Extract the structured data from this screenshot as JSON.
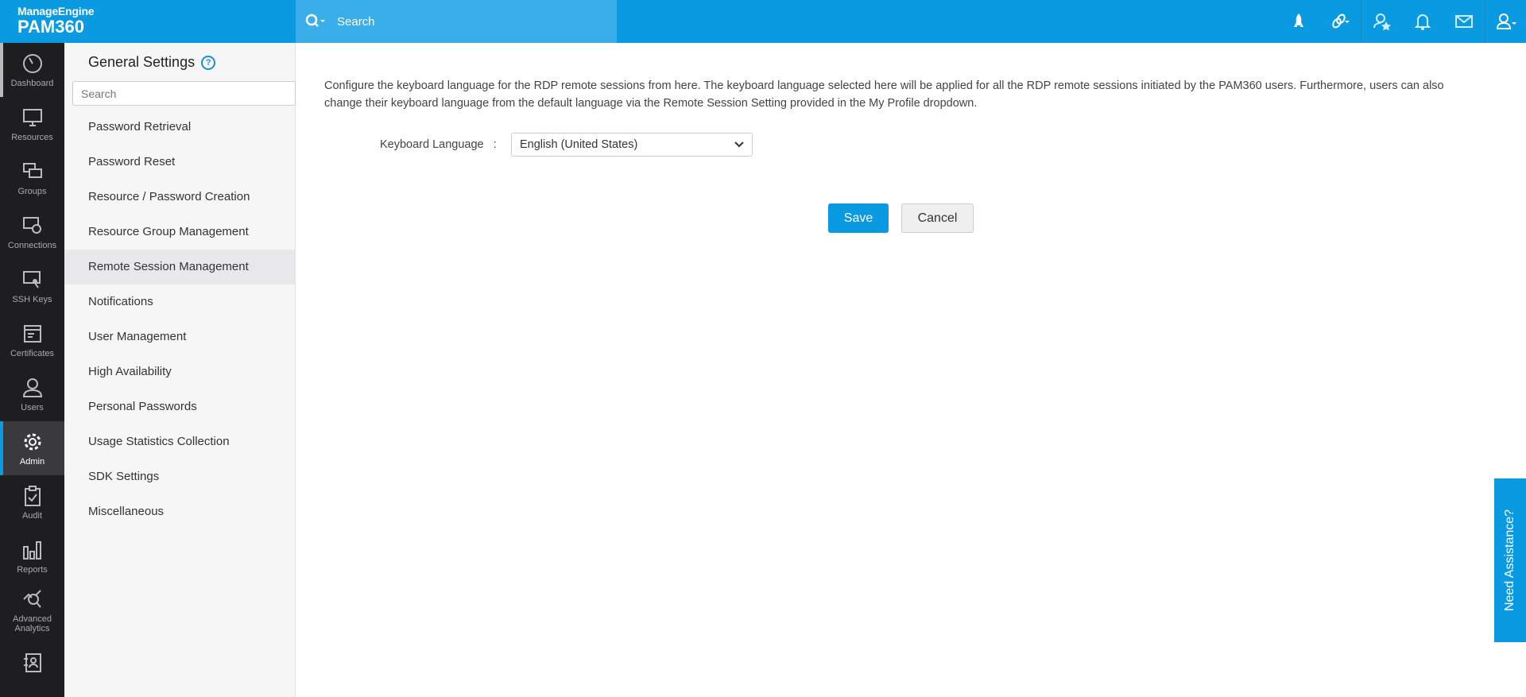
{
  "header": {
    "brand": "ManageEngine",
    "product": "PAM360",
    "search_placeholder": "Search",
    "icons": [
      "rocket-icon",
      "link-icon",
      "user-star-icon",
      "bell-icon",
      "mail-icon",
      "user-icon"
    ]
  },
  "sidebar": {
    "items": [
      {
        "label": "Dashboard",
        "icon": "gauge-icon"
      },
      {
        "label": "Resources",
        "icon": "monitor-icon"
      },
      {
        "label": "Groups",
        "icon": "groups-icon"
      },
      {
        "label": "Connections",
        "icon": "connections-icon"
      },
      {
        "label": "SSH Keys",
        "icon": "key-icon"
      },
      {
        "label": "Certificates",
        "icon": "certificate-icon"
      },
      {
        "label": "Users",
        "icon": "user-icon"
      },
      {
        "label": "Admin",
        "icon": "gear-icon",
        "active": true
      },
      {
        "label": "Audit",
        "icon": "clipboard-icon"
      },
      {
        "label": "Reports",
        "icon": "bar-chart-icon"
      },
      {
        "label": "Advanced Analytics",
        "icon": "analytics-icon"
      },
      {
        "label": "",
        "icon": "contact-icon"
      }
    ]
  },
  "settings": {
    "title": "General Settings",
    "search_placeholder": "Search",
    "menu": [
      "Password Retrieval",
      "Password Reset",
      "Resource / Password Creation",
      "Resource Group Management",
      "Remote Session Management",
      "Notifications",
      "User Management",
      "High Availability",
      "Personal Passwords",
      "Usage Statistics Collection",
      "SDK Settings",
      "Miscellaneous"
    ],
    "selected": "Remote Session Management"
  },
  "main": {
    "description": "Configure the keyboard language for the RDP remote sessions from here. The keyboard language selected here will be applied for all the RDP remote sessions initiated by the PAM360 users. Furthermore, users can also change their keyboard language from the default language via the Remote Session Setting provided in the My Profile dropdown.",
    "keyboard_label": "Keyboard Language",
    "colon": ":",
    "keyboard_value": "English (United States)",
    "save": "Save",
    "cancel": "Cancel"
  },
  "assist": "Need Assistance?",
  "colors": {
    "brand": "#0a9ae2",
    "sidebar": "#1e1e20"
  }
}
